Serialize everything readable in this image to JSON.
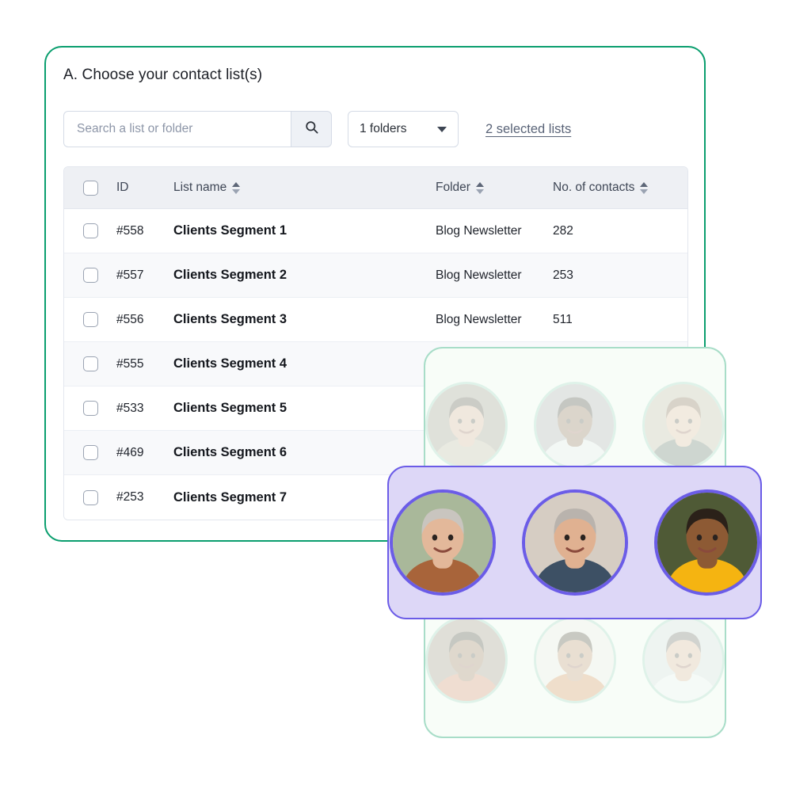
{
  "panel": {
    "title": "A. Choose your contact list(s)",
    "border_color": "#0a9e6e"
  },
  "toolbar": {
    "search_placeholder": "Search a list or folder",
    "search_value": "",
    "search_icon": "search-icon",
    "folders_label": "1 folders",
    "folders_caret_icon": "chevron-down-icon",
    "selected_lists_link": "2 selected lists"
  },
  "table": {
    "columns": [
      {
        "key": "checkbox",
        "label": "",
        "sortable": false
      },
      {
        "key": "id",
        "label": "ID",
        "sortable": false
      },
      {
        "key": "name",
        "label": "List name",
        "sortable": true
      },
      {
        "key": "folder",
        "label": "Folder",
        "sortable": true
      },
      {
        "key": "count",
        "label": "No. of contacts",
        "sortable": true
      }
    ],
    "rows": [
      {
        "id": "#558",
        "name": "Clients Segment 1",
        "folder": "Blog Newsletter",
        "count": "282",
        "checked": false
      },
      {
        "id": "#557",
        "name": "Clients Segment 2",
        "folder": "Blog Newsletter",
        "count": "253",
        "checked": false
      },
      {
        "id": "#556",
        "name": "Clients Segment 3",
        "folder": "Blog Newsletter",
        "count": "511",
        "checked": false
      },
      {
        "id": "#555",
        "name": "Clients Segment 4",
        "folder": "",
        "count": "",
        "checked": false
      },
      {
        "id": "#533",
        "name": "Clients Segment 5",
        "folder": "",
        "count": "",
        "checked": false
      },
      {
        "id": "#469",
        "name": "Clients Segment 6",
        "folder": "",
        "count": "",
        "checked": false
      },
      {
        "id": "#253",
        "name": "Clients Segment 7",
        "folder": "",
        "count": "",
        "checked": false
      }
    ]
  },
  "avatar_cards": {
    "green": {
      "background": "#f8fdf8",
      "border_color": "#a8ddc8",
      "ring_color": "#8ad0b6",
      "top_row": [
        {
          "name": "avatar-woman-apron",
          "skin": "#d8a184",
          "hair": "#2f2119",
          "bg": "#8c8275",
          "clothes": "#b8a894"
        },
        {
          "name": "avatar-man-white-tee",
          "skin": "#7a4a2e",
          "hair": "#140d08",
          "bg": "#9a9aa2",
          "clothes": "#e6e8ef"
        },
        {
          "name": "avatar-woman-curly-hair",
          "skin": "#e0ae8d",
          "hair": "#6a4226",
          "bg": "#b6a894",
          "clothes": "#3d5248"
        }
      ],
      "bottom_row": [
        {
          "name": "avatar-man-beanie",
          "skin": "#8b5a37",
          "hair": "#1a1008",
          "bg": "#8d7a6c",
          "clothes": "#d2714a"
        },
        {
          "name": "avatar-woman-afro",
          "skin": "#b87a4e",
          "hair": "#241509",
          "bg": "#efeae3",
          "clothes": "#d4762f"
        },
        {
          "name": "avatar-man-glasses-shirt",
          "skin": "#d9a585",
          "hair": "#4a4340",
          "bg": "#cdd5dc",
          "clothes": "#eef1f4"
        }
      ]
    },
    "purple": {
      "background": "#ddd7f7",
      "border_color": "#6b5ce7",
      "ring_color": "#6b5ce7",
      "row": [
        {
          "name": "avatar-senior-woman-glasses",
          "skin": "#e3b89a",
          "hair": "#c9c5bf",
          "bg": "#a9b89a",
          "clothes": "#a8643a"
        },
        {
          "name": "avatar-senior-man-beard",
          "skin": "#e0b191",
          "hair": "#b9b3ad",
          "bg": "#d6cdc3",
          "clothes": "#3d5064"
        },
        {
          "name": "avatar-woman-headwrap",
          "skin": "#8d5a34",
          "hair": "#2b2119",
          "bg": "#4f5a36",
          "clothes": "#f5b411"
        }
      ]
    }
  }
}
